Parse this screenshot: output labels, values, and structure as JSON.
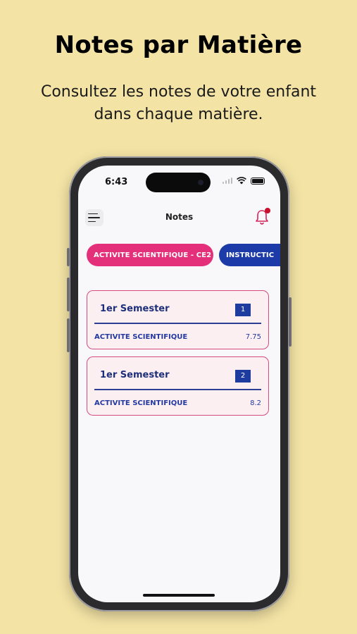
{
  "promo": {
    "title": "Notes par Matière",
    "subtitle_line1": "Consultez les notes de votre enfant",
    "subtitle_line2": "dans chaque matière."
  },
  "status_bar": {
    "time": "6:43",
    "icons": [
      "signal-icon",
      "wifi-icon",
      "battery-icon"
    ]
  },
  "nav": {
    "title": "Notes",
    "menu_icon": "hamburger-menu-icon",
    "bell_icon": "bell-icon",
    "has_notification": true
  },
  "tabs": [
    {
      "label": "ACTIVITE SCIENTIFIQUE - CE2",
      "active": true
    },
    {
      "label": "INSTRUCTIC",
      "active": false
    }
  ],
  "cards": [
    {
      "semester": "1er Semester",
      "number": "1",
      "subject": "ACTIVITE SCIENTIFIQUE",
      "grade": "7.75"
    },
    {
      "semester": "1er Semester",
      "number": "2",
      "subject": "ACTIVITE SCIENTIFIQUE",
      "grade": "8.2"
    }
  ],
  "colors": {
    "background": "#F3E3A5",
    "active_tab": "#E4307A",
    "inactive_tab": "#1D3BA8",
    "card_border": "#D64A7D",
    "card_fill": "#FBEFF2",
    "text_blue": "#1E2F7A",
    "notification": "#C8102E"
  }
}
